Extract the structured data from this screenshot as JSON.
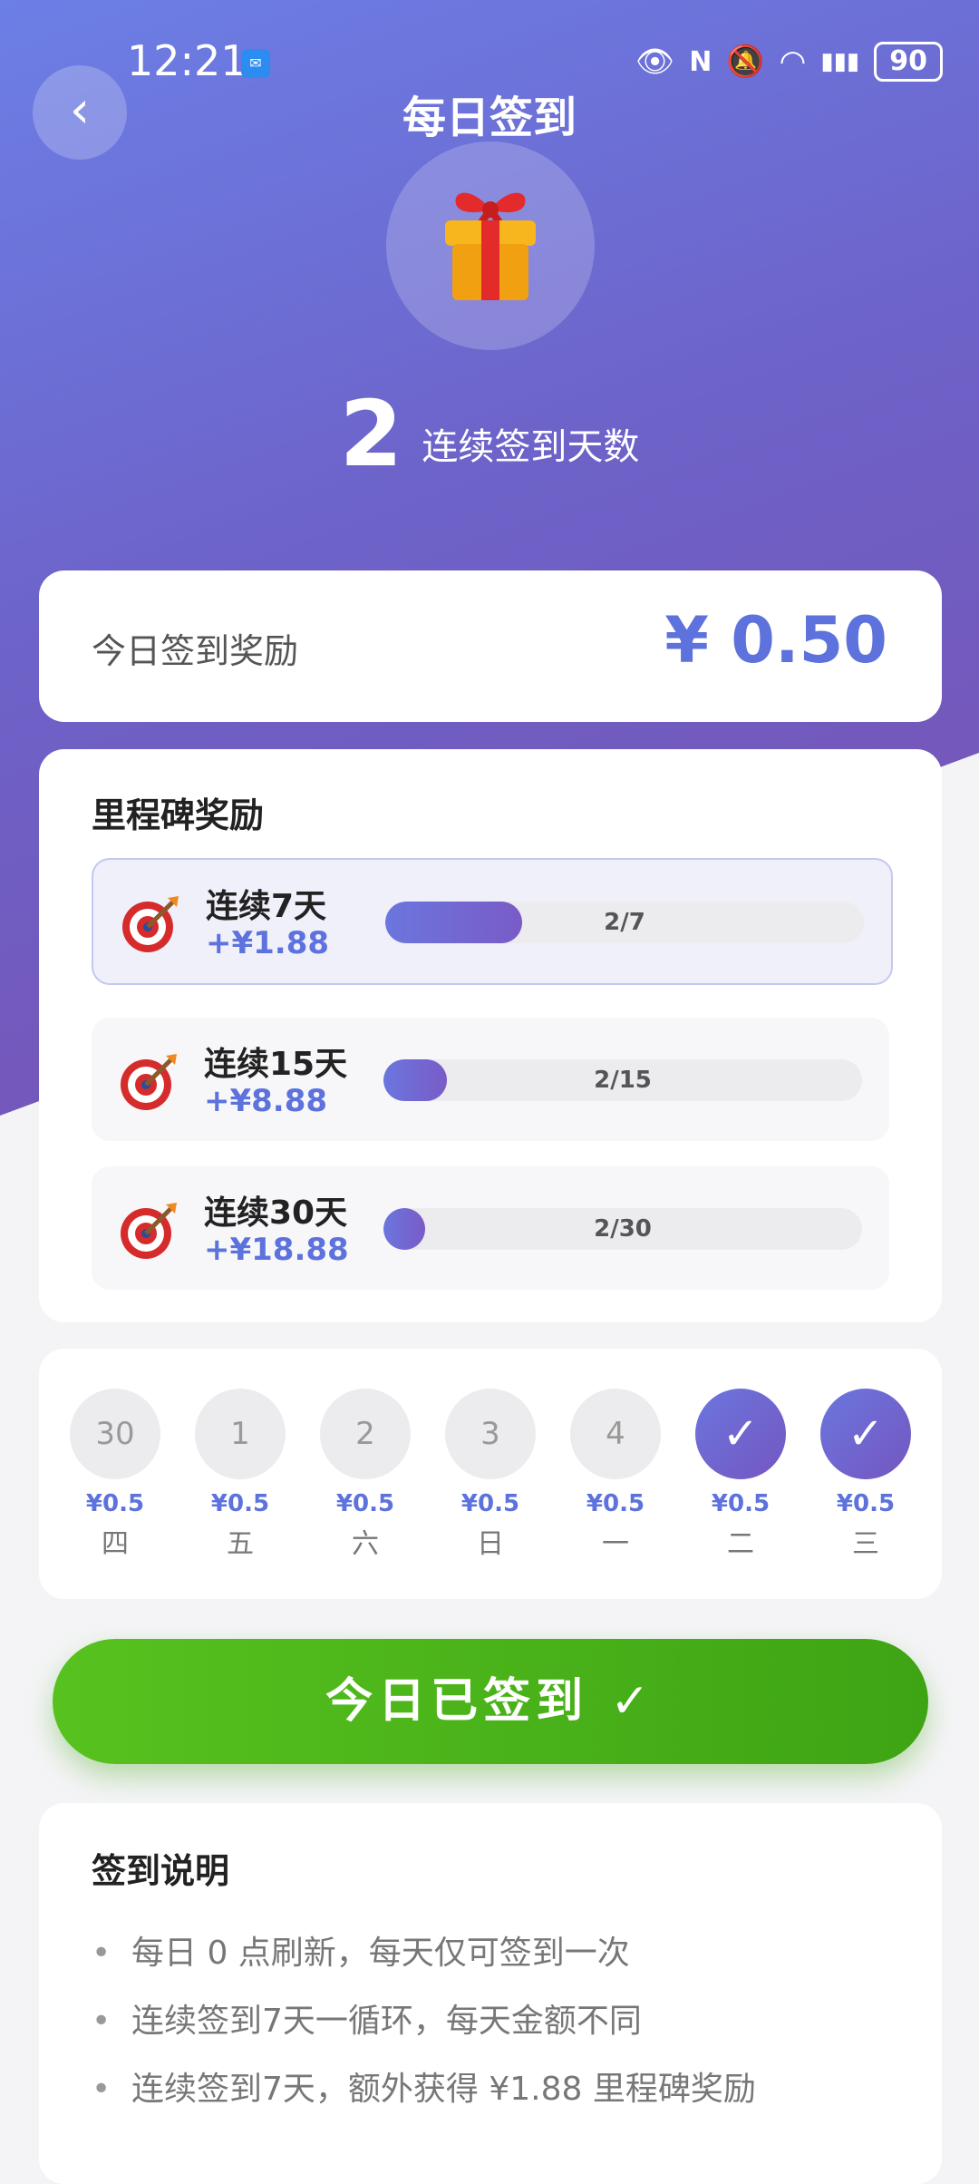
{
  "status_bar": {
    "time": "12:21",
    "battery": "90"
  },
  "header": {
    "title": "每日签到"
  },
  "streak": {
    "days": "2",
    "label": "连续签到天数"
  },
  "today": {
    "label": "今日签到奖励",
    "amount": "¥ 0.50"
  },
  "milestones": {
    "title": "里程碑奖励",
    "items": [
      {
        "name": "连续7天",
        "reward": "+¥1.88",
        "progress_text": "2/7",
        "current": 2,
        "target": 7
      },
      {
        "name": "连续15天",
        "reward": "+¥8.88",
        "progress_text": "2/15",
        "current": 2,
        "target": 15
      },
      {
        "name": "连续30天",
        "reward": "+¥18.88",
        "progress_text": "2/30",
        "current": 2,
        "target": 30
      }
    ]
  },
  "days": [
    {
      "date": "30",
      "amount": "¥0.5",
      "weekday": "四",
      "checked": false
    },
    {
      "date": "1",
      "amount": "¥0.5",
      "weekday": "五",
      "checked": false
    },
    {
      "date": "2",
      "amount": "¥0.5",
      "weekday": "六",
      "checked": false
    },
    {
      "date": "3",
      "amount": "¥0.5",
      "weekday": "日",
      "checked": false
    },
    {
      "date": "4",
      "amount": "¥0.5",
      "weekday": "一",
      "checked": false
    },
    {
      "date": "✓",
      "amount": "¥0.5",
      "weekday": "二",
      "checked": true
    },
    {
      "date": "✓",
      "amount": "¥0.5",
      "weekday": "三",
      "checked": true
    }
  ],
  "sign_button": {
    "label": "今日已签到 ✓"
  },
  "rules": {
    "title": "签到说明",
    "items": [
      "每日 0 点刷新，每天仅可签到一次",
      "连续签到7天一循环，每天金额不同",
      "连续签到7天，额外获得 ¥1.88 里程碑奖励"
    ]
  },
  "colors": {
    "accent": "#5d72dc",
    "success": "#4bb319",
    "hero_start": "#6c7fe6",
    "hero_end": "#7a4fb0"
  }
}
